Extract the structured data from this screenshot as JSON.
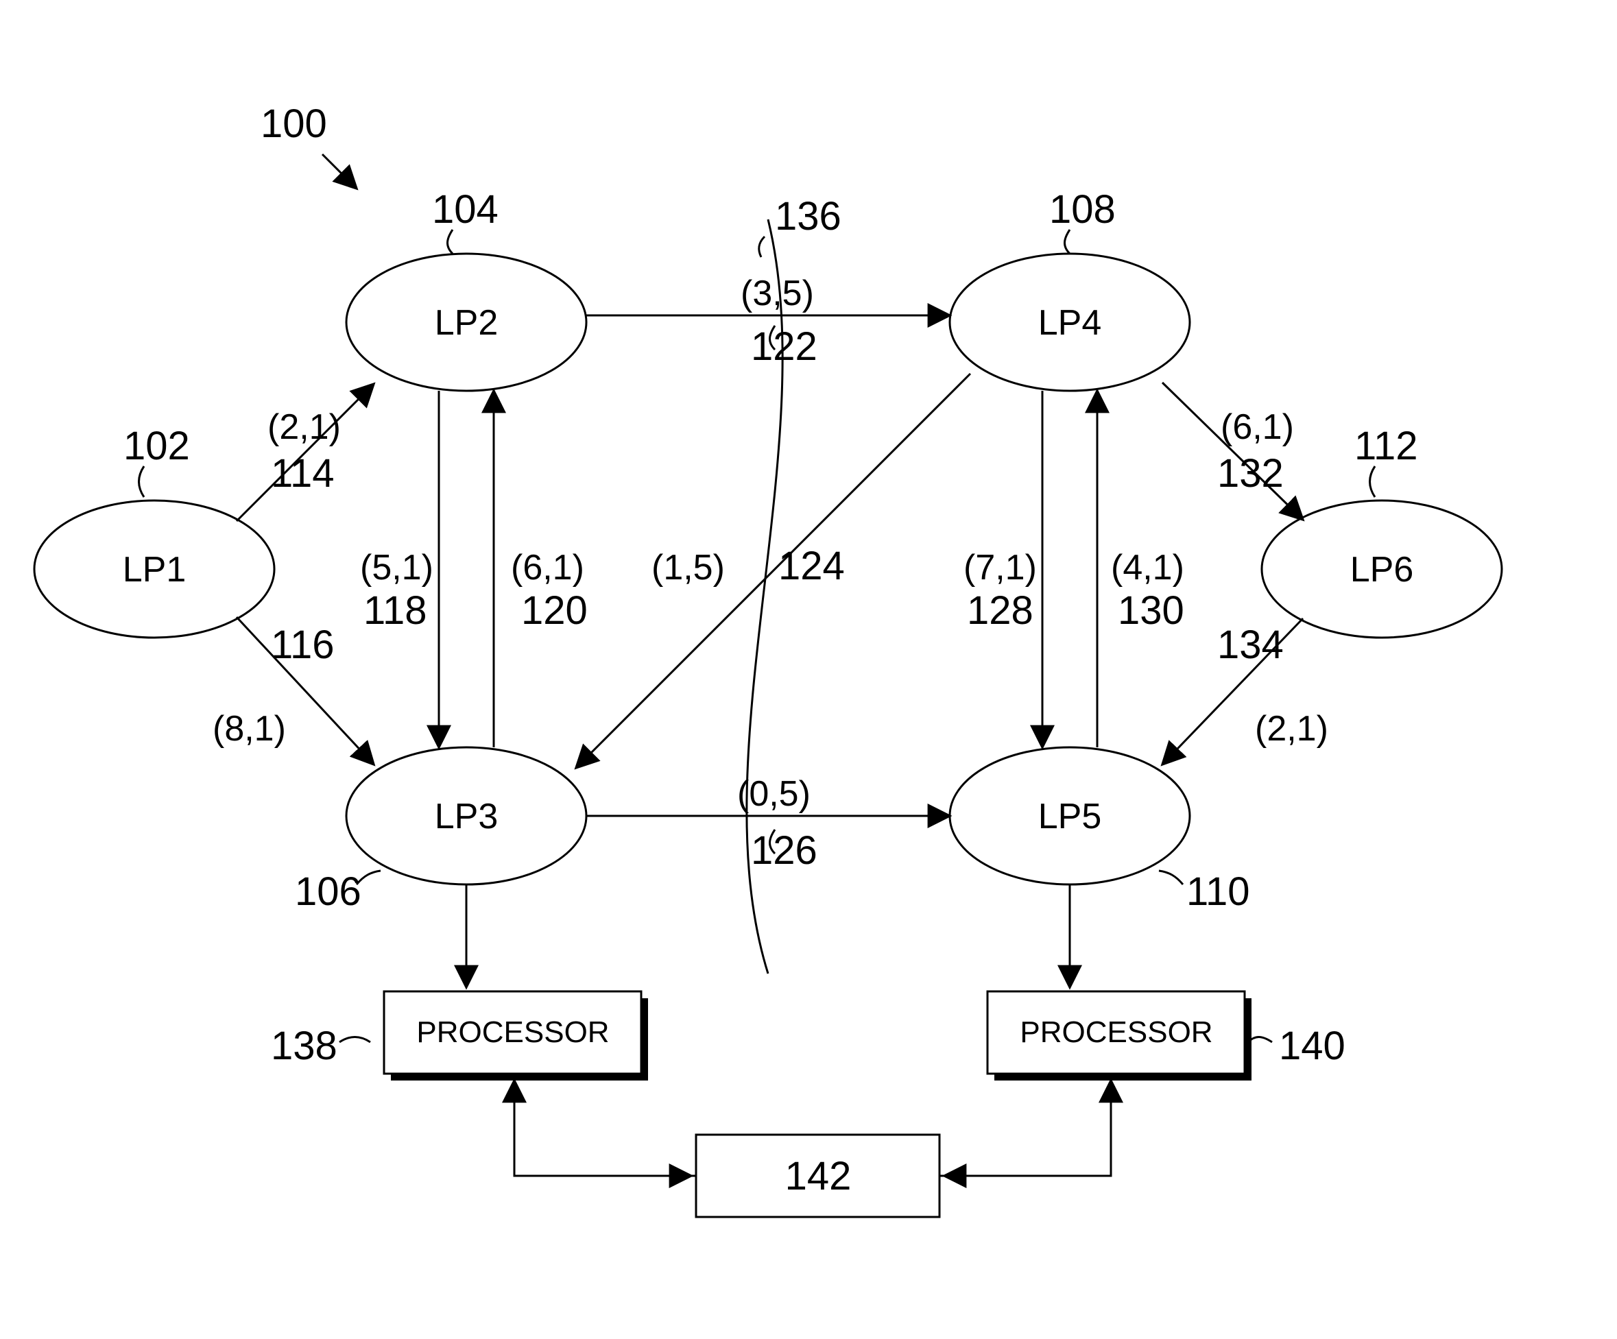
{
  "figure_ref": "100",
  "nodes": {
    "lp1": {
      "label": "LP1",
      "ref": "102"
    },
    "lp2": {
      "label": "LP2",
      "ref": "104"
    },
    "lp3": {
      "label": "LP3",
      "ref": "106"
    },
    "lp4": {
      "label": "LP4",
      "ref": "108"
    },
    "lp5": {
      "label": "LP5",
      "ref": "110"
    },
    "lp6": {
      "label": "LP6",
      "ref": "112"
    }
  },
  "edges": {
    "e114": {
      "weight": "(2,1)",
      "ref": "114"
    },
    "e116": {
      "weight": "(8,1)",
      "ref": "116"
    },
    "e118": {
      "weight": "(5,1)",
      "ref": "118"
    },
    "e120": {
      "weight": "(6,1)",
      "ref": "120"
    },
    "e122": {
      "weight": "(3,5)",
      "ref": "122"
    },
    "e124": {
      "weight": "(1,5)",
      "ref": "124"
    },
    "e126": {
      "weight": "(0,5)",
      "ref": "126"
    },
    "e128": {
      "weight": "(7,1)",
      "ref": "128"
    },
    "e130": {
      "weight": "(4,1)",
      "ref": "130"
    },
    "e132": {
      "weight": "(6,1)",
      "ref": "132"
    },
    "e134": {
      "weight": "(2,1)",
      "ref": "134"
    }
  },
  "partition": {
    "ref": "136"
  },
  "processors": {
    "left": {
      "label": "PROCESSOR",
      "ref": "138"
    },
    "right": {
      "label": "PROCESSOR",
      "ref": "140"
    }
  },
  "shared_block": {
    "ref": "142"
  }
}
